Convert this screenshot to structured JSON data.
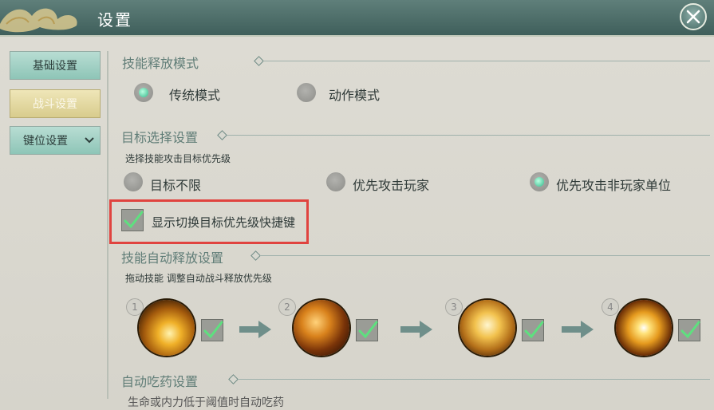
{
  "window": {
    "title": "设置"
  },
  "sidebar": {
    "tabs": [
      {
        "label": "基础设置"
      },
      {
        "label": "战斗设置"
      },
      {
        "label": "键位设置"
      }
    ]
  },
  "skill_release": {
    "title": "技能释放模式",
    "options": [
      {
        "label": "传统模式",
        "selected": true
      },
      {
        "label": "动作模式",
        "selected": false
      }
    ]
  },
  "target_select": {
    "title": "目标选择设置",
    "hint": "选择技能攻击目标优先级",
    "options": [
      {
        "label": "目标不限",
        "selected": false
      },
      {
        "label": "优先攻击玩家",
        "selected": false
      },
      {
        "label": "优先攻击非玩家单位",
        "selected": true
      }
    ],
    "shortcut_checkbox": {
      "label": "显示切换目标优先级快捷键",
      "checked": true
    }
  },
  "auto_skill": {
    "title": "技能自动释放设置",
    "hint": "拖动技能 调整自动战斗释放优先级",
    "slots": [
      {
        "number": "1",
        "checked": true
      },
      {
        "number": "2",
        "checked": true
      },
      {
        "number": "3",
        "checked": true
      },
      {
        "number": "4",
        "checked": true
      }
    ]
  },
  "auto_potion": {
    "title": "自动吃药设置",
    "hint_partial": "生命或内力低于阈值时自动吃药"
  },
  "colors": {
    "accent": "#33b88b",
    "highlight": "#e0433f",
    "titlebar": "#4f6f6b"
  }
}
